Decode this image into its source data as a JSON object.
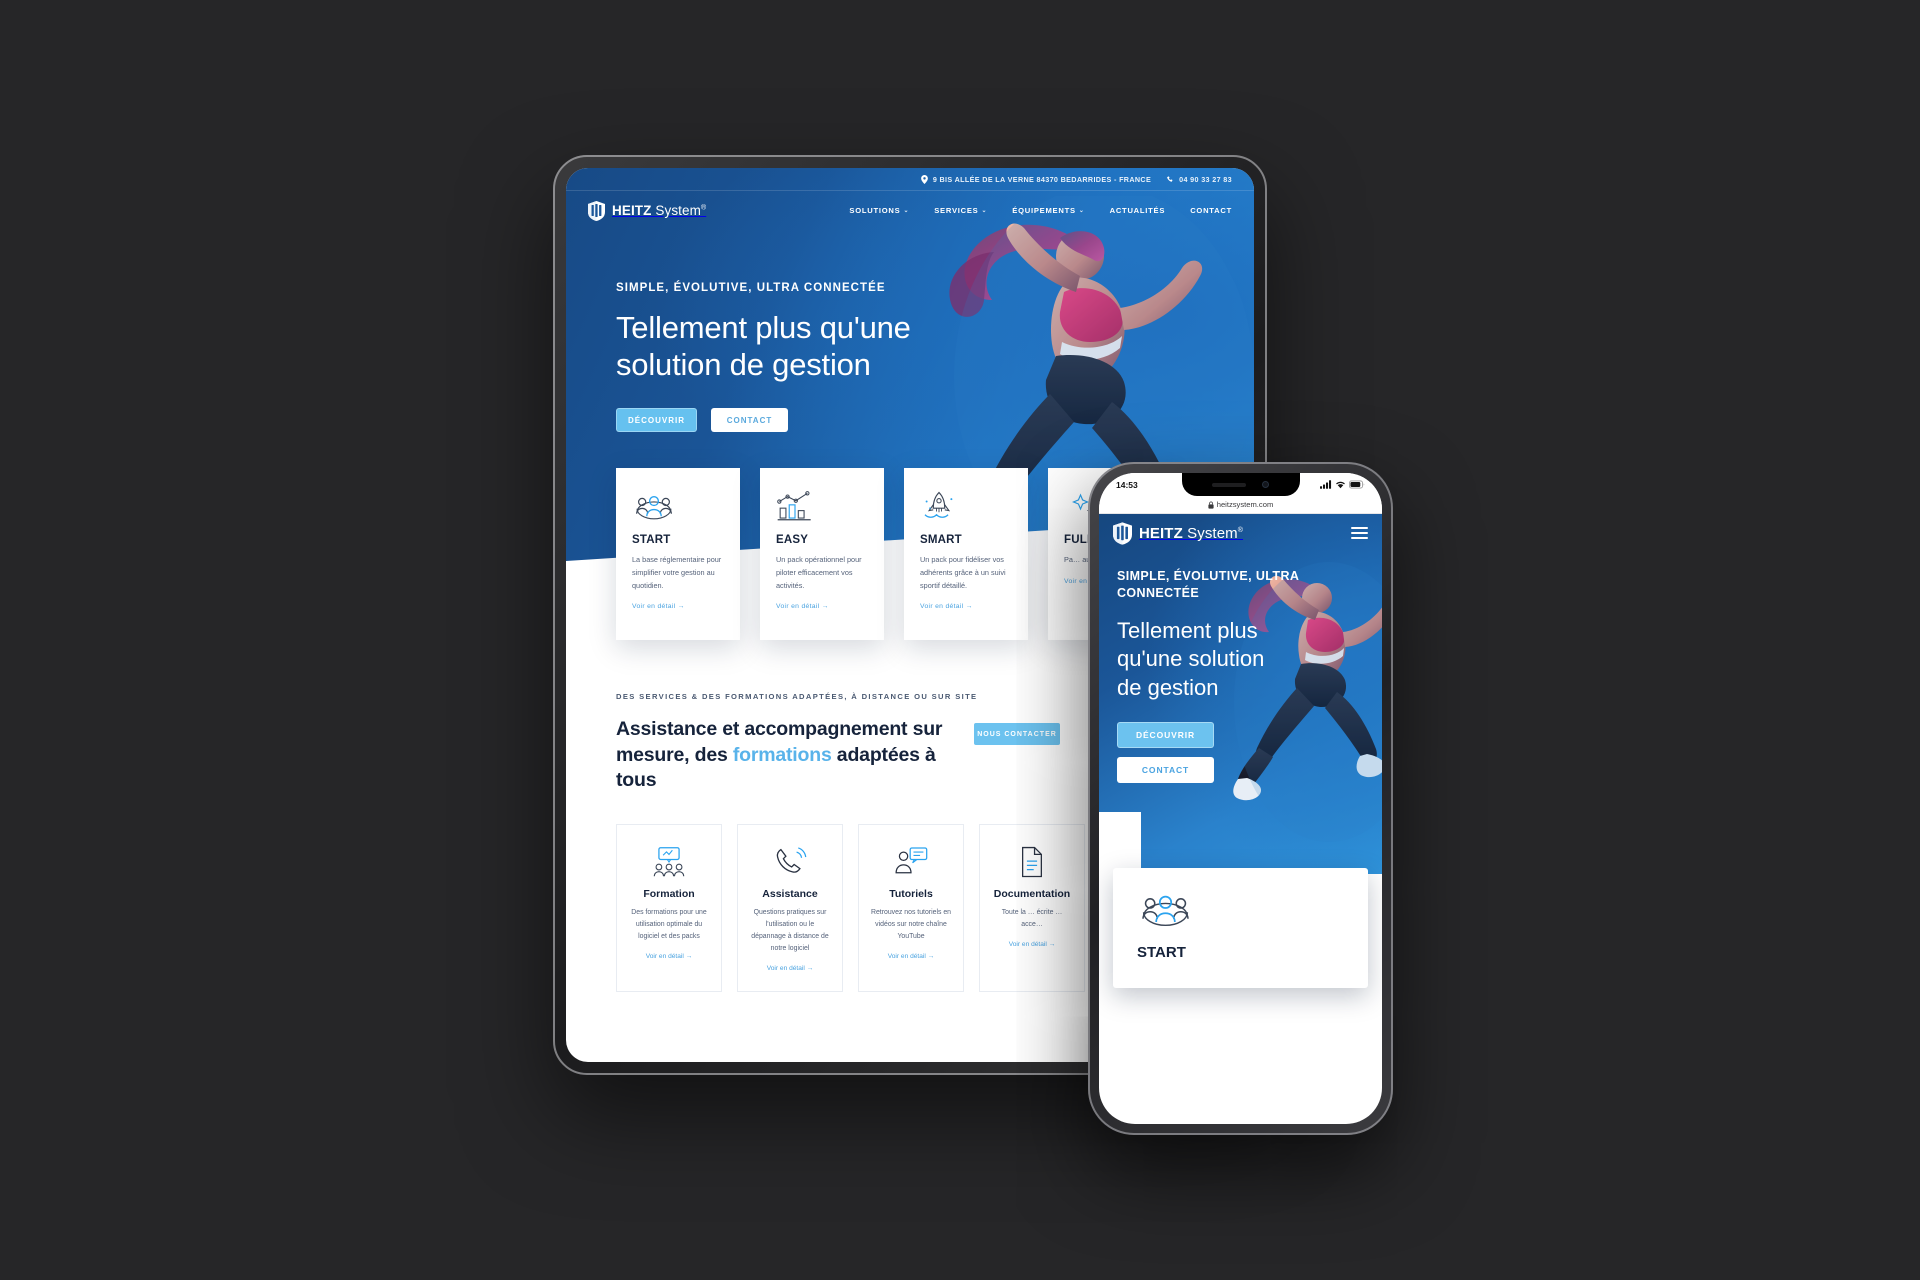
{
  "theme": {
    "bg": "#262628",
    "brand_blue": "#1b5698",
    "accent_light": "#66c1ef",
    "link_blue": "#4aa3e0",
    "dark_text": "#16233b"
  },
  "tablet": {
    "topbar": {
      "address": "9 BIS ALLÉE DE LA VERNE 84370 BEDARRIDES - FRANCE",
      "phone": "04 90 33 27 83"
    },
    "logo": {
      "bold": "HEITZ",
      "light": "System",
      "mark": "®"
    },
    "nav": [
      {
        "label": "SOLUTIONS",
        "caret": "⌄"
      },
      {
        "label": "SERVICES",
        "caret": "⌄"
      },
      {
        "label": "ÉQUIPEMENTS",
        "caret": "⌄"
      },
      {
        "label": "ACTUALITÉS",
        "caret": ""
      },
      {
        "label": "CONTACT",
        "caret": ""
      }
    ],
    "hero": {
      "kicker": "SIMPLE, ÉVOLUTIVE, ULTRA CONNECTÉE",
      "title": "Tellement plus qu'une solution de gestion",
      "cta_primary": "DÉCOUVRIR",
      "cta_secondary": "CONTACT"
    },
    "packs": [
      {
        "icon": "people-group-icon",
        "title": "START",
        "text": "La base réglementaire pour simplifier votre gestion au quotidien.",
        "link": "Voir en détail →"
      },
      {
        "icon": "bar-chart-icon",
        "title": "EASY",
        "text": "Un pack opérationnel pour piloter efficacement vos activités.",
        "link": "Voir en détail →"
      },
      {
        "icon": "rocket-icon",
        "title": "SMART",
        "text": "Un pack pour fidéliser vos adhérents grâce à un suivi sportif détaillé.",
        "link": "Voir en détail →"
      },
      {
        "icon": "sparkle-icon",
        "title": "FULL",
        "text": "Pa… au… co… m…",
        "link": "Voir en détail →"
      }
    ],
    "services": {
      "label": "DES SERVICES & DES FORMATIONS ADAPTÉES, À DISTANCE OU SUR SITE",
      "title_part1": "Assistance et accompagnement sur mesure, des ",
      "title_highlight": "formations",
      "title_part2": " adaptées à tous",
      "button": "NOUS CONTACTER",
      "cards": [
        {
          "icon": "training-board-icon",
          "title": "Formation",
          "text": "Des formations pour une utilisation optimale du logiciel et des packs",
          "link": "Voir en détail →"
        },
        {
          "icon": "phone-ring-icon",
          "title": "Assistance",
          "text": "Questions pratiques sur l'utilisation ou le dépannage à distance de notre logiciel",
          "link": "Voir en détail →"
        },
        {
          "icon": "user-chat-icon",
          "title": "Tutoriels",
          "text": "Retrouvez nos tutoriels en vidéos sur notre chaîne YouTube",
          "link": "Voir en détail →"
        },
        {
          "icon": "document-icon",
          "title": "Documentation",
          "text": "Toute la … écrite … acce…",
          "link": "Voir en détail →"
        }
      ]
    }
  },
  "phone": {
    "status": {
      "time": "14:53",
      "signal_icon": "cellular-bars-icon",
      "wifi_icon": "wifi-icon",
      "battery_icon": "battery-icon"
    },
    "browser": {
      "lock_icon": "lock-icon",
      "url": "heitzsystem.com"
    },
    "logo": {
      "bold": "HEITZ",
      "light": "System",
      "mark": "®"
    },
    "menu_icon": "hamburger-menu-icon",
    "hero": {
      "kicker": "SIMPLE, ÉVOLUTIVE, ULTRA CONNECTÉE",
      "title": "Tellement plus qu'une solution de gestion",
      "cta_primary": "DÉCOUVRIR",
      "cta_secondary": "CONTACT"
    },
    "card": {
      "icon": "people-group-icon",
      "title": "START"
    }
  }
}
